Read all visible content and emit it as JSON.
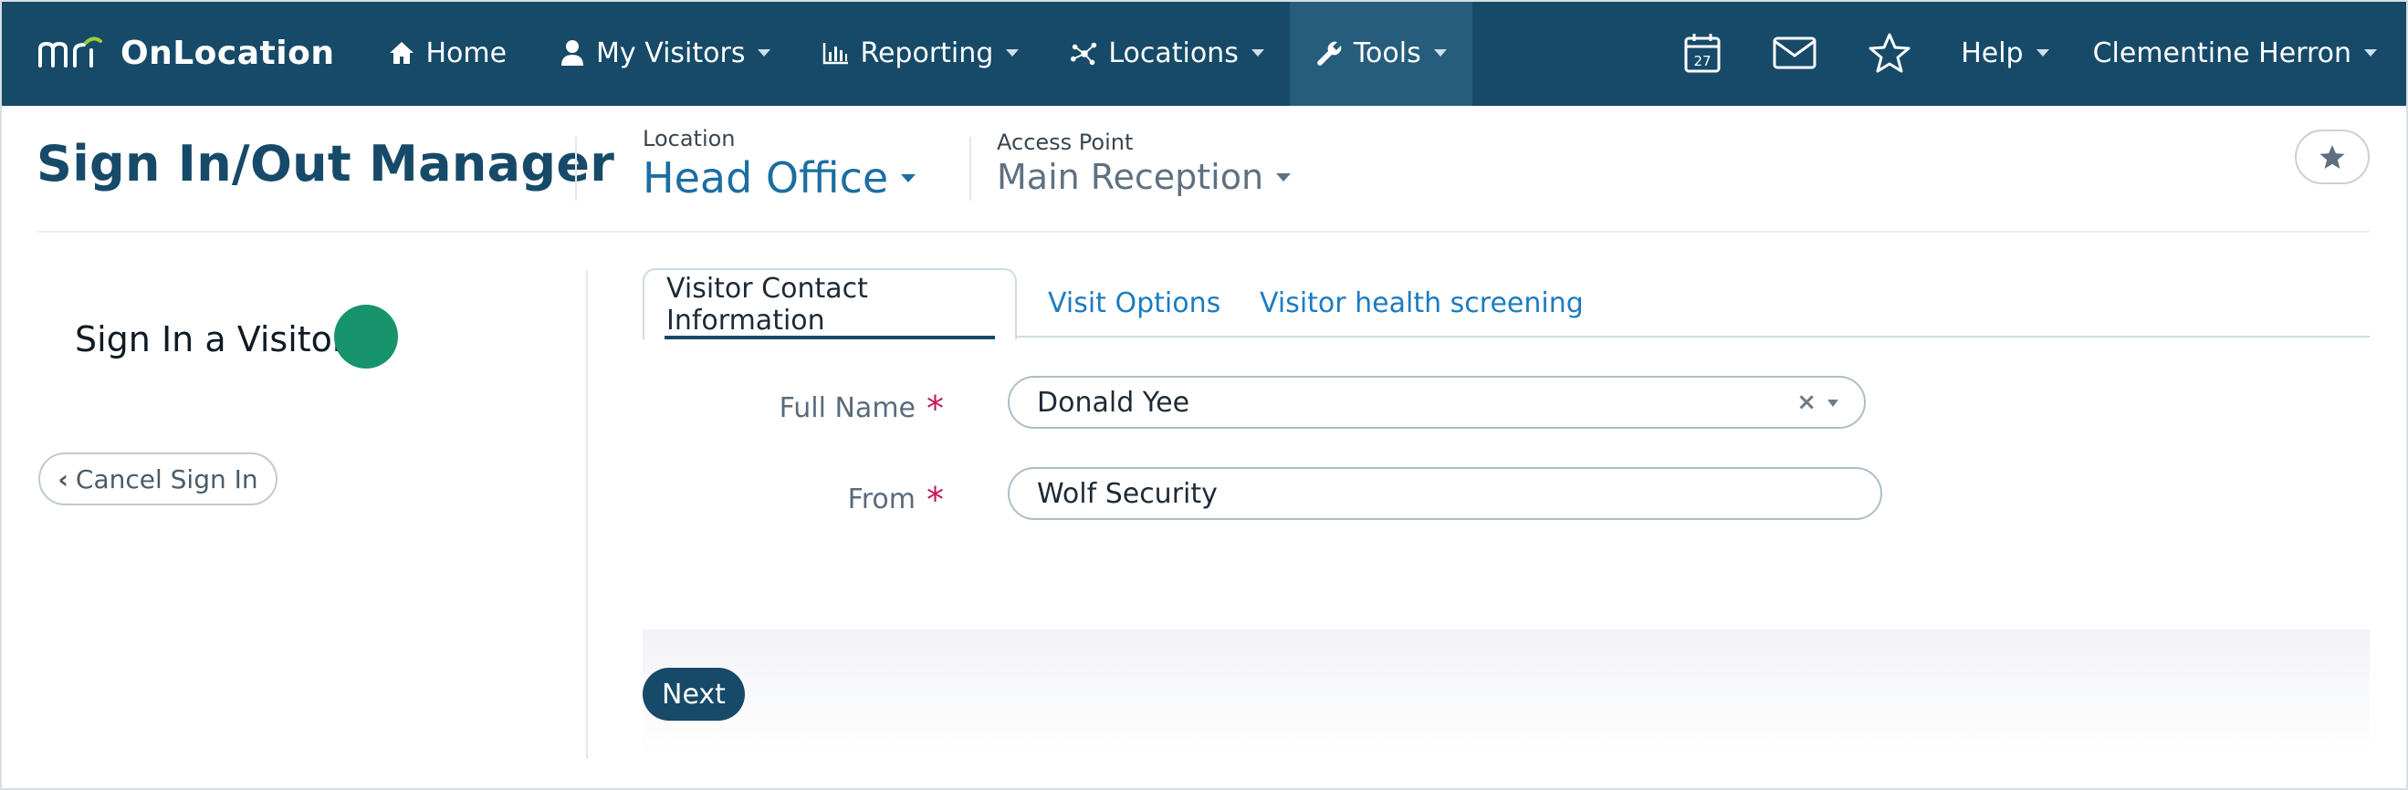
{
  "app": {
    "brand": "OnLocation",
    "logo_text": "mri",
    "colors": {
      "nav_bg": "#164a68",
      "accent": "#1b6ea1",
      "status_green": "#17946b",
      "required": "#c2185b"
    }
  },
  "nav": {
    "home": "Home",
    "my_visitors": "My Visitors",
    "reporting": "Reporting",
    "locations": "Locations",
    "tools": "Tools",
    "calendar_day": "27",
    "help": "Help",
    "user": "Clementine Herron",
    "icons": [
      "home-icon",
      "user-icon",
      "bar-chart-icon",
      "network-icon",
      "wrench-icon",
      "calendar-icon",
      "mail-icon",
      "star-icon"
    ]
  },
  "header": {
    "title": "Sign In/Out Manager",
    "location_label": "Location",
    "location_value": "Head Office",
    "access_point_label": "Access Point",
    "access_point_value": "Main Reception"
  },
  "left_panel": {
    "title": "Sign In a Visitor",
    "cancel_label": "Cancel Sign In"
  },
  "tabs": [
    {
      "label": "Visitor Contact Information",
      "active": true
    },
    {
      "label": "Visit Options",
      "active": false
    },
    {
      "label": "Visitor health screening",
      "active": false
    }
  ],
  "form": {
    "full_name_label": "Full Name",
    "full_name_value": "Donald Yee",
    "from_label": "From",
    "from_value": "Wolf Security",
    "required_mark": "*"
  },
  "footer": {
    "next_label": "Next"
  }
}
